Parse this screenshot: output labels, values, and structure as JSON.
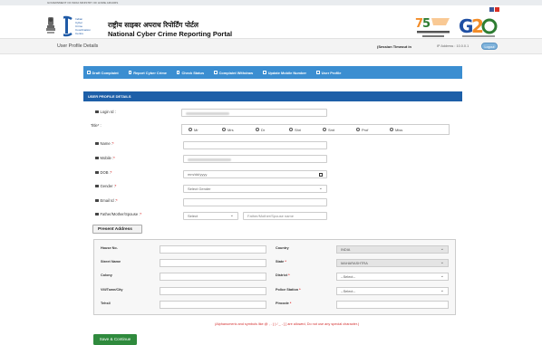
{
  "gov_strip": {
    "left": "GOVERNMENT OF INDIA",
    "right": "MINISTRY OF HOME AFFAIRS"
  },
  "header": {
    "portal_hindi": "राष्ट्रीय साइबर अपराध रिपोर्टिंग पोर्टल",
    "portal_english": "National Cyber Crime Reporting Portal",
    "i4c_text": [
      "Indian",
      "Cyber",
      "Crime",
      "Coordination",
      "Centre"
    ]
  },
  "subheader": {
    "title": "User Profile Details",
    "session_label": "(Session Timeout in",
    "ip_address": "IP Address : 10.0.0.1",
    "logout_label": "Logout"
  },
  "nav": {
    "items": [
      "Draft Complaint",
      "Report Cyber Crime",
      "Check Status",
      "Complaint Withdraw",
      "Update Mobile Number",
      "User Profile"
    ]
  },
  "section_title": "USER PROFILE DETAILS",
  "form": {
    "login_label": "Login Id :",
    "title_label": "Title* :",
    "title_options": [
      "Mr",
      "Mrs",
      "Dr",
      "Shri",
      "Smt",
      "Prof",
      "Miss"
    ],
    "name_label": "Name :",
    "mobile_label": "Mobile :",
    "dob_label": "DOB :",
    "dob_placeholder": "mm/dd/yyyy",
    "gender_label": "Gender :",
    "gender_value": "Select Gender",
    "email_label": "Email Id :",
    "relation_label": "Father/Mother/Spouse :",
    "relation_select": "Select",
    "relation_placeholder": "Father/Mother/Spouse name",
    "required_mark": "*"
  },
  "present_address": {
    "button_label": "Present Address",
    "left_labels": [
      "House No.",
      "Street Name",
      "Colony",
      "Vill/Town/City",
      "Tehsil"
    ],
    "right_labels": [
      "Country",
      "State",
      "District",
      "Police Station",
      "Pincode"
    ],
    "country_value": "INDIA",
    "state_value": "MAHARASHTRA",
    "district_value": "--Select--",
    "police_station_value": "--Select--"
  },
  "note": "(Alphanumeric and symbols like @ , . ( ) / _ - [ ] are allowed, Do not use any special character.)",
  "save_label": "Save & Continue",
  "colors": {
    "nav_blue": "#3b8ed1",
    "section_blue": "#1d5fa8",
    "save_green": "#2f8a3d",
    "warning_red": "#d32f2f"
  }
}
